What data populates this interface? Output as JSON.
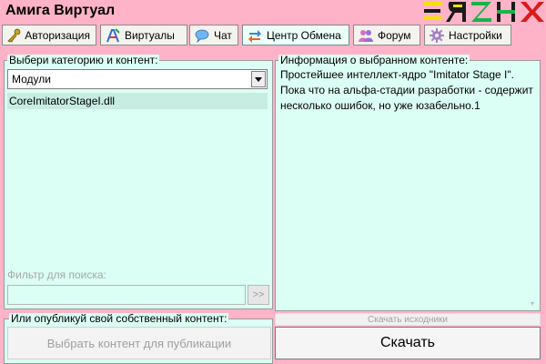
{
  "app": {
    "title": "Амига Виртуал"
  },
  "tabs": [
    {
      "label": "Авторизация",
      "icon": "key-icon"
    },
    {
      "label": "Виртуалы",
      "icon": "a-letter-icon"
    },
    {
      "label": "Чат",
      "icon": "chat-bubble-icon"
    },
    {
      "label": "Центр Обмена",
      "icon": "exchange-arrows-icon",
      "active": true
    },
    {
      "label": "Форум",
      "icon": "people-icon"
    },
    {
      "label": "Настройки",
      "icon": "gear-icon"
    }
  ],
  "left_panel": {
    "legend": "Выбери категорию и контент:",
    "category_selected": "Модули",
    "items": [
      "CoreImitatorStageI.dll"
    ],
    "filter_label": "Фильтр для поиска:",
    "filter_value": "",
    "filter_button": ">>"
  },
  "right_panel": {
    "legend": "Информация о выбранном контенте:",
    "text": "Простейшее интеллект-ядро \"Imitator Stage I\". Пока что на альфа-стадии разработки - содержит несколько ошибок, но уже юзабельно.1"
  },
  "publish_panel": {
    "legend": "Или опубликуй свой собственный контент:",
    "button": "Выбрать контент для публикации"
  },
  "actions": {
    "download_sources": "Скачать исходники",
    "download": "Скачать"
  },
  "colors": {
    "background": "#ffb3c8",
    "panel": "#dbfff4",
    "selected_row": "#c7ece2",
    "logo": [
      "#f5e100",
      "#1a1a1a",
      "#1ab34a",
      "#d81b1b"
    ]
  }
}
